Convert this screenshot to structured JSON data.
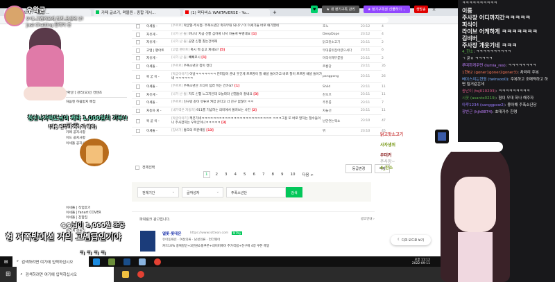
{
  "stream": {
    "streamer": "우왁굳",
    "title": "9시) 고멤가요제 티저 공개의 날!",
    "category": "Just Chatting 플레이 중"
  },
  "browser": {
    "tabs": [
      "카페 글쓰기 : 왁물원 ...",
      "카페 글쓰기, 왁물원 : 종합 게시...",
      "(1) 왁타버스 WAKTAVERSE - Yo..."
    ],
    "new_tab": "+",
    "url": "cafe.naver.com/steamindiegame"
  },
  "topbar": {
    "subscribe_manage": "내 정기구독 관리",
    "gift_sub": "정기구독권 선물하기",
    "live_badge": "생방송"
  },
  "board": {
    "rows": [
      {
        "cat": "이세돌 -",
        "head": "[주르르]",
        "title": "왁굳형-주시접- 주폭소년단 축하무대 되나? / 이 이세기들 바로 얘기했네",
        "comments": "",
        "author": "호노",
        "time": "23:12",
        "views": "4"
      },
      {
        "cat": "자유게 -",
        "head": "[나가 난 돌]",
        "title": "버니나 지금 신뿅 심하게 나서 차놓게 투명네요",
        "comments": "[1]",
        "author": "DeepDope",
        "time": "23:12",
        "views": "4"
      },
      {
        "cat": "자유게 -",
        "head": "[나가 난 돌]",
        "title": "곰엔 신챕 찾는건어뫠",
        "comments": "",
        "author": "닭고맛소고기",
        "time": "23:11",
        "views": "2"
      },
      {
        "cat": "고멤 | 팬아트",
        "head": "[고멤 팬아트]",
        "title": "혹시 뭐 듣고 계세요?",
        "comments": "[5]",
        "author": "무대룰뒤집어렸으셔다",
        "time": "23:11",
        "views": "6"
      },
      {
        "cat": "자유게 -",
        "head": "[나가 난 돌]",
        "title": "빼빼로시",
        "comments": "[1]",
        "author": "머리어깨무릎발",
        "time": "23:11",
        "views": "2"
      },
      {
        "cat": "이세돌 -",
        "head": "[주르르]",
        "title": "주폭소년단 참이 컷다",
        "comments": "",
        "author": "르릉당",
        "time": "23:11",
        "views": "35"
      },
      {
        "cat": "왁 굳 이 -",
        "head": "[왁굳이야기]",
        "title": "아닐ㅋㅋㅋㅋㅋㅋㅋ 칸피망이 준내 웃긴게 르르땅이 찰 채널 들어가고 바로 찰이 르르땅 채널 들어가네 ㅋㅋㅋㅋㅋㅋ",
        "comments": "",
        "author": "pangpong",
        "time": "23:11",
        "views": "26"
      },
      {
        "cat": "이세돌 -",
        "head": "[주르르]",
        "title": "주폭소년단 드디어 텀라 뒤는 건가요?",
        "comments": "[1]",
        "author": "Shild",
        "time": "23:11",
        "views": "11"
      },
      {
        "cat": "자유게 -",
        "head": "[나가 난 돌]",
        "title": "저도 신챕 느그지인데 오늘따라 신챕들이 잘네요",
        "comments": "[3]",
        "author": "찬오므",
        "time": "23:11",
        "views": "11"
      },
      {
        "cat": "이세돌 -",
        "head": "[주르르]",
        "title": "친구랑 같이 유튜브 켜잡 운다고 너 친구 없잖아 ㅋㅋ",
        "comments": "",
        "author": "주퓨릅",
        "time": "23:11",
        "views": "7"
      },
      {
        "cat": "자동차 게 -",
        "head": "[내기력은 자동차]",
        "title": "911를 기념하는 의미에서 올려보는 사진",
        "comments": "[2]",
        "author": "자늘선",
        "time": "23:11",
        "views": "11"
      },
      {
        "cat": "왁 굳 이 -",
        "head": "[왁굳이야기]",
        "title": "케웃기네ㅋㅋㅋㅋㅋㅋㅋㅋㅋㅋㅋㅋㅋㅋㅋㅋㅋㅋㅋㅋㅋㅋㅋㅋ ㅋㅋㅋ그걸 또 바로 말하는 철수들이나 주사잡히는 우왁굳이나ㅋㅋㅋㅋㅋ",
        "comments": "[3]",
        "author": "남만연는렉쇼",
        "time": "23:10",
        "views": "47"
      },
      {
        "cat": "이세돌 -",
        "head": "[징버거]",
        "title": "통모의 트윈에일",
        "comments": "[13]",
        "author": "뷔",
        "time": "23:10",
        "views": "45"
      }
    ],
    "select_all": "전체선택",
    "grade_change": "등급변경",
    "delete": "삭제",
    "pages": [
      "1",
      "2",
      "3",
      "4",
      "5",
      "6",
      "7",
      "8",
      "9",
      "10"
    ],
    "next": "다음 >",
    "search": {
      "period": "전체기간",
      "scope": "글작성자",
      "query": "주폭소년단",
      "button": "검색"
    }
  },
  "ad": {
    "header": "파워링크 광고입니다.",
    "guide": "광고안내 ›",
    "title": "엘롯·롯데온",
    "url": "https://www.lotteon.com",
    "pay": "N Pay",
    "cats": "유아동패션 · 여성의류 · 남성의류 · 언더웨어",
    "desc": "카드10% 중복할인+3만원쇼핑쿠폰+네이버페이 추가적립+친구에 4장 쿠폰 헤일",
    "dark_mode": "다크 모드로 보기"
  },
  "sidebar": {
    "items": [
      "[확인!] 관리(오)인 컨텐츠",
      "처음엔 허웜받지 배집",
      "공지사항",
      "카페 공지사항",
      "이드 공지사항",
      "이세돌 공지사항",
      "이세돌 | 직업후기",
      "이세돌 | fanart COVER",
      "이세돌 | 찬합집",
      "윤간계 샌출집"
    ]
  },
  "overlays": {
    "donation1": "청신나가팍도님이 캐타 1,000원치 기부!!",
    "donation1_sub": "(대충 잔무리 거적 지 뭐야)",
    "donation2": "○○님이 1,000원 조공",
    "donation2_msg": "헝 저쪽방에선 거의 고멤급인기야",
    "kkk": "ㅋ ㅋ ㅋ ㅋ"
  },
  "chat": {
    "messages": [
      {
        "user": "",
        "text": "ㅋㅋㅋㅋㅋㅋㅋㅋㅋㅋ",
        "big": false
      },
      {
        "user": "",
        "text": "이름",
        "big": true
      },
      {
        "user": "",
        "text": "주사장 어디까지간ㅋㅋㅋㅋㅋ",
        "big": true
      },
      {
        "user": "",
        "text": "피식이",
        "big": true
      },
      {
        "user": "",
        "text": "라이브 어케하게 ㅋㅋㅋㅋㅋㅋㅋ",
        "big": true
      },
      {
        "user": "",
        "text": "김비버_",
        "big": true
      },
      {
        "user": "",
        "text": "주사장 개웃기네 ㅋㅋㅋ",
        "big": true
      },
      {
        "user": "4_한소",
        "text": "ㅋㅋㅋㅋㅋㅋㅋㅋㅋㅋ",
        "big": false
      },
      {
        "user": "",
        "text": "ㄱ 굳ㅇ ㅋㅋㅋㅋㅋ",
        "big": false
      },
      {
        "user": "루띠하게주먼 (lumia_res)",
        "text": "ㅋㅋㅋㅋㅋㅋㅋㅋ",
        "big": false
      },
      {
        "user": "1한62 (goner1goner2goner3)",
        "text": "차라리 주복",
        "big": false
      },
      {
        "user": "베이스치는현원 (twinsoo0)",
        "text": "주복하고 조매력하고 하면 될거같은데",
        "big": false
      },
      {
        "user": "송난이 (tsj010203)",
        "text": "ㅋㅋㅋㅋㅋㅋㅋㅋㅋ",
        "big": false
      },
      {
        "user": "시꿋 (asante0219)",
        "text": "형이 무대 하나 해주자",
        "big": false
      },
      {
        "user": "아루1234 (sanggpow2)",
        "text": "좋아해 주폭소년당",
        "big": false
      },
      {
        "user": "장빈근 (hjh8874)",
        "text": "초대가수 한명",
        "big": false
      }
    ],
    "side_names": [
      "닭고맛소고기",
      "사자생위",
      "우미커",
      "주사장~",
      "4_한소"
    ]
  },
  "taskbar": {
    "search_placeholder": "검색하려면 여기에 입력하십시오",
    "time": "오후 11:12",
    "date": "2022-09-11"
  },
  "colors": {
    "naver_green": "#03c75a",
    "twitch_purple": "#9147ff",
    "chat_bg": "#18181b",
    "live_red": "#e00000"
  }
}
